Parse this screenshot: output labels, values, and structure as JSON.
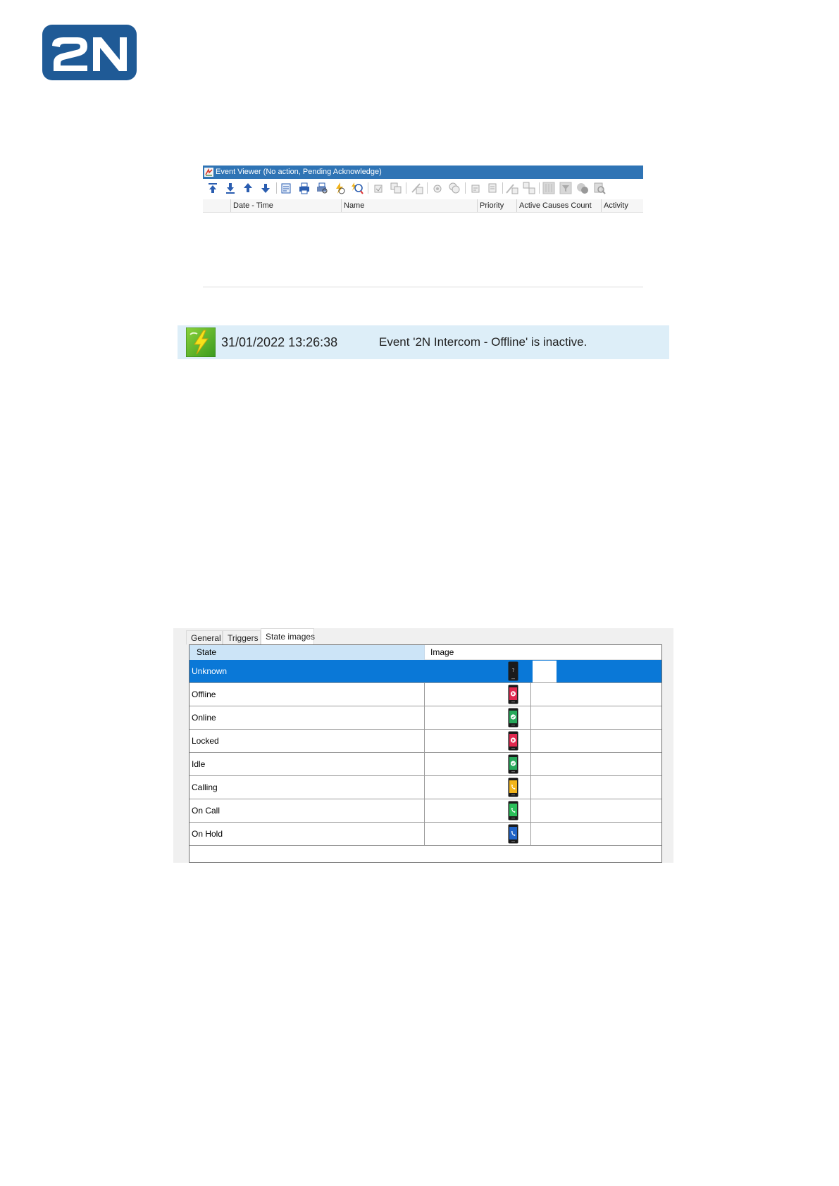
{
  "logo": {
    "text": "2N",
    "color": "#1f5a96"
  },
  "event_viewer": {
    "title": "Event Viewer (No action, Pending Acknowledge)",
    "title_bar_color": "#2f74b5",
    "toolbar_icons": [
      "move-top-icon",
      "move-bottom-icon",
      "move-up-icon",
      "move-down-icon",
      "export-icon",
      "print-icon",
      "print-preview-icon",
      "acknowledge-icon",
      "search-icon",
      "check-icon",
      "check-all-icon",
      "close-event-icon",
      "settings-icon",
      "settings-all-icon",
      "note-icon",
      "copy-icon",
      "group-icon",
      "group-edit-icon",
      "grid-icon",
      "filter-icon",
      "delete-icon",
      "properties-icon"
    ],
    "columns": [
      "Date - Time",
      "Name",
      "Priority",
      "Active Causes Count",
      "Activity"
    ]
  },
  "notification": {
    "datetime": "31/01/2022 13:26:38",
    "message": "Event '2N Intercom - Offline' is inactive.",
    "icon": "lightning-event-icon",
    "background": "#ddeef8"
  },
  "state_images": {
    "tabs": [
      "General",
      "Triggers",
      "State images"
    ],
    "active_tab": "State images",
    "columns": {
      "state": "State",
      "image": "Image"
    },
    "rows": [
      {
        "state": "Unknown",
        "icon": "device-unknown-icon",
        "color": "#1b1b1b",
        "selected": true
      },
      {
        "state": "Offline",
        "icon": "device-offline-icon",
        "color": "#e0284f"
      },
      {
        "state": "Online",
        "icon": "device-online-icon",
        "color": "#27a85a"
      },
      {
        "state": "Locked",
        "icon": "device-locked-icon",
        "color": "#e0284f"
      },
      {
        "state": "Idle",
        "icon": "device-idle-icon",
        "color": "#27a85a"
      },
      {
        "state": "Calling",
        "icon": "device-calling-icon",
        "color": "#f2b41b"
      },
      {
        "state": "On Call",
        "icon": "device-oncall-icon",
        "color": "#2bbf5a"
      },
      {
        "state": "On Hold",
        "icon": "device-onhold-icon",
        "color": "#1f63c6"
      }
    ],
    "selection_color": "#0a78d7"
  }
}
